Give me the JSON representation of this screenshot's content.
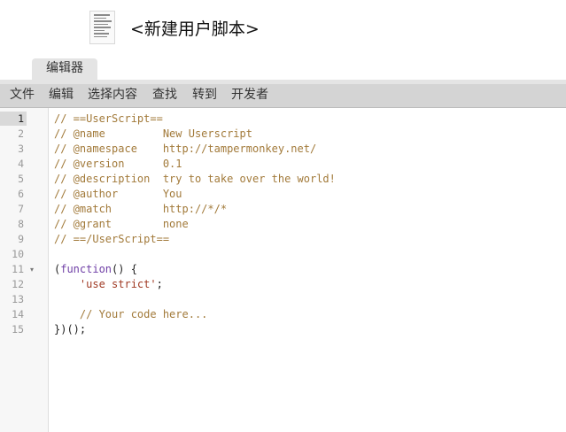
{
  "header": {
    "title": "<新建用户脚本>",
    "thumbnail_icon": "script-document-icon"
  },
  "tabs": [
    {
      "label": "编辑器",
      "active": true
    }
  ],
  "menubar": {
    "items": [
      {
        "label": "文件"
      },
      {
        "label": "编辑"
      },
      {
        "label": "选择内容"
      },
      {
        "label": "查找"
      },
      {
        "label": "转到"
      },
      {
        "label": "开发者"
      }
    ]
  },
  "editor": {
    "active_line": 1,
    "fold_icon": "fold-triangle-icon",
    "fold_glyph": "▾",
    "lines": [
      {
        "num": "1",
        "tokens": [
          {
            "t": "// ==UserScript==",
            "c": "comment"
          }
        ]
      },
      {
        "num": "2",
        "tokens": [
          {
            "t": "// @name         New Userscript",
            "c": "comment"
          }
        ]
      },
      {
        "num": "3",
        "tokens": [
          {
            "t": "// @namespace    http://tampermonkey.net/",
            "c": "comment"
          }
        ]
      },
      {
        "num": "4",
        "tokens": [
          {
            "t": "// @version      0.1",
            "c": "comment"
          }
        ]
      },
      {
        "num": "5",
        "tokens": [
          {
            "t": "// @description  try to take over the world!",
            "c": "comment"
          }
        ]
      },
      {
        "num": "6",
        "tokens": [
          {
            "t": "// @author       You",
            "c": "comment"
          }
        ]
      },
      {
        "num": "7",
        "tokens": [
          {
            "t": "// @match        http://*/*",
            "c": "comment"
          }
        ]
      },
      {
        "num": "8",
        "tokens": [
          {
            "t": "// @grant        none",
            "c": "comment"
          }
        ]
      },
      {
        "num": "9",
        "tokens": [
          {
            "t": "// ==/UserScript==",
            "c": "comment"
          }
        ]
      },
      {
        "num": "10",
        "tokens": []
      },
      {
        "num": "11",
        "fold": true,
        "tokens": [
          {
            "t": "(",
            "c": "punct"
          },
          {
            "t": "function",
            "c": "keyword"
          },
          {
            "t": "() {",
            "c": "punct"
          }
        ]
      },
      {
        "num": "12",
        "tokens": [
          {
            "t": "    ",
            "c": "punct"
          },
          {
            "t": "'use strict'",
            "c": "string"
          },
          {
            "t": ";",
            "c": "punct"
          }
        ]
      },
      {
        "num": "13",
        "tokens": []
      },
      {
        "num": "14",
        "tokens": [
          {
            "t": "    // Your code here...",
            "c": "comment"
          }
        ]
      },
      {
        "num": "15",
        "tokens": [
          {
            "t": "})();",
            "c": "punct"
          }
        ]
      }
    ]
  }
}
